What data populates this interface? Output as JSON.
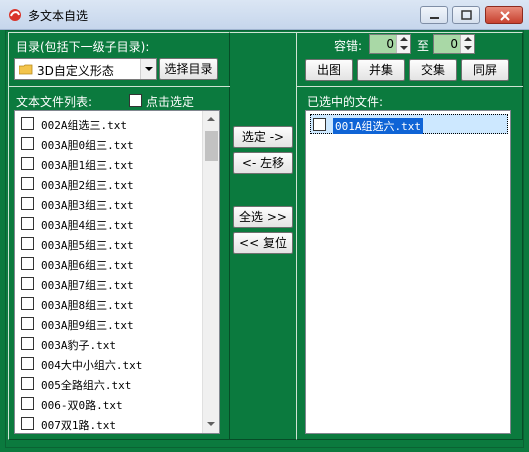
{
  "window": {
    "title": "多文本自选"
  },
  "left": {
    "dir_label": "目录(包括下一级子目录):",
    "dir_value": "3D自定义形态",
    "choose_dir_button": "选择目录",
    "file_list_label": "文本文件列表:",
    "click_select_label": "点击选定",
    "files": [
      "002A组选三.txt",
      "003A胆0组三.txt",
      "003A胆1组三.txt",
      "003A胆2组三.txt",
      "003A胆3组三.txt",
      "003A胆4组三.txt",
      "003A胆5组三.txt",
      "003A胆6组三.txt",
      "003A胆7组三.txt",
      "003A胆8组三.txt",
      "003A胆9组三.txt",
      "003A豹子.txt",
      "004大中小组六.txt",
      "005全路组六.txt",
      "006-双0路.txt",
      "007双1路.txt"
    ]
  },
  "middle": {
    "select_button": "选定 ->",
    "left_move_button": "<- 左移",
    "select_all_button": "全选 >>",
    "reset_button": "<< 复位"
  },
  "right": {
    "tolerance_label": "容错:",
    "tolerance_from": "0",
    "to_label": "至",
    "tolerance_to": "0",
    "buttons": [
      "出图",
      "并集",
      "交集",
      "同屏"
    ],
    "selected_label": "已选中的文件:",
    "selected_files": [
      "001A组选六.txt"
    ]
  }
}
